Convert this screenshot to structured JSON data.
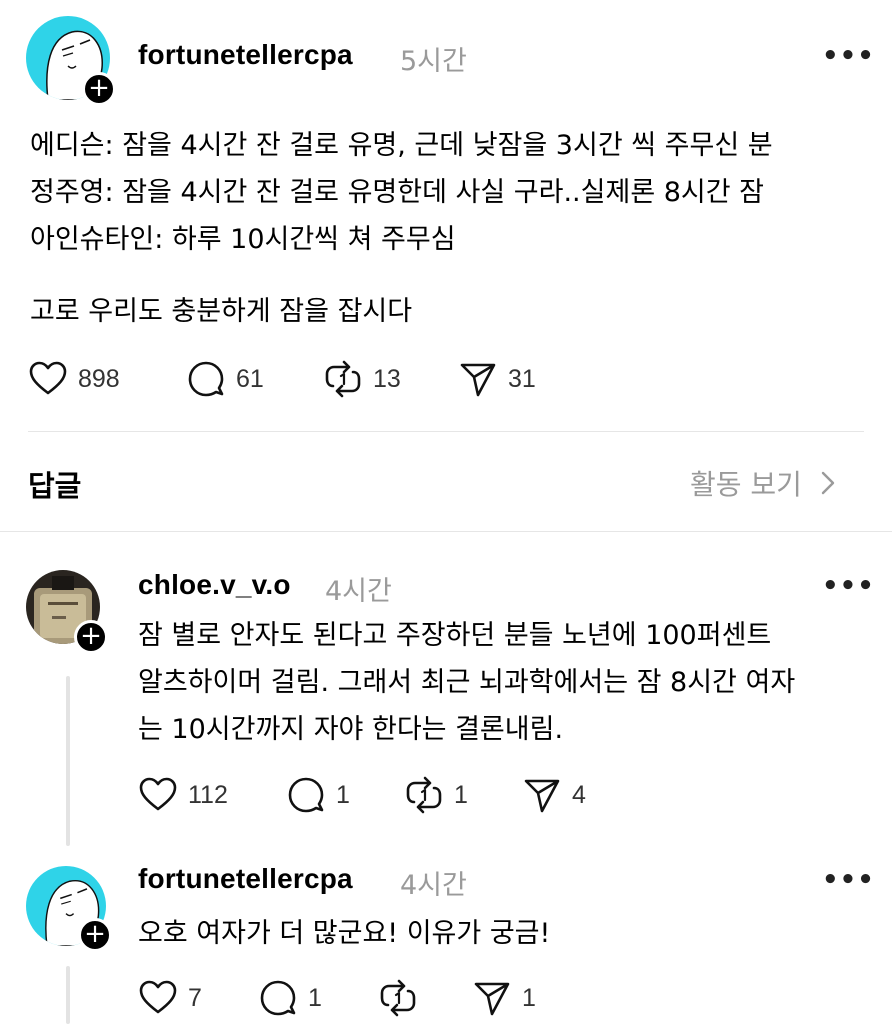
{
  "main_post": {
    "username": "fortunetellercpa",
    "time": "5시간",
    "more": "•••",
    "lines": [
      "에디슨: 잠을 4시간 잔 걸로 유명, 근데 낮잠을 3시간 씩 주무신 분",
      "정주영: 잠을 4시간 잔 걸로 유명한데 사실 구라..실제론 8시간 잠",
      "아인슈타인: 하루 10시간씩 쳐 주무심"
    ],
    "closing": "고로 우리도 충분하게 잠을 잡시다",
    "likes": "898",
    "comments": "61",
    "reposts": "13",
    "shares": "31"
  },
  "replies_header": {
    "title": "답글",
    "activity_link": "활동 보기",
    "chevron": "›"
  },
  "replies": [
    {
      "username": "chloe.v_v.o",
      "time": "4시간",
      "more": "•••",
      "lines": [
        "잠 별로 안자도 된다고 주장하던 분들 노년에 100퍼센트",
        "알츠하이머 걸림. 그래서 최근 뇌과학에서는 잠 8시간 여자",
        "는 10시간까지 자야 한다는 결론내림."
      ],
      "likes": "112",
      "comments": "1",
      "reposts": "1",
      "shares": "4"
    },
    {
      "username": "fortunetellercpa",
      "time": "4시간",
      "more": "•••",
      "lines": [
        "오호 여자가 더 많군요!  이유가 궁금!"
      ],
      "likes": "7",
      "comments": "1",
      "reposts": "",
      "shares": "1"
    }
  ],
  "colors": {
    "avatar_cyan": "#2fd3e8",
    "muted_text": "#9a9a9a",
    "divider": "#e6e6e6"
  },
  "icons": [
    "heart-icon",
    "comment-icon",
    "repost-icon",
    "share-icon",
    "plus-icon",
    "more-icon",
    "chevron-right-icon"
  ]
}
